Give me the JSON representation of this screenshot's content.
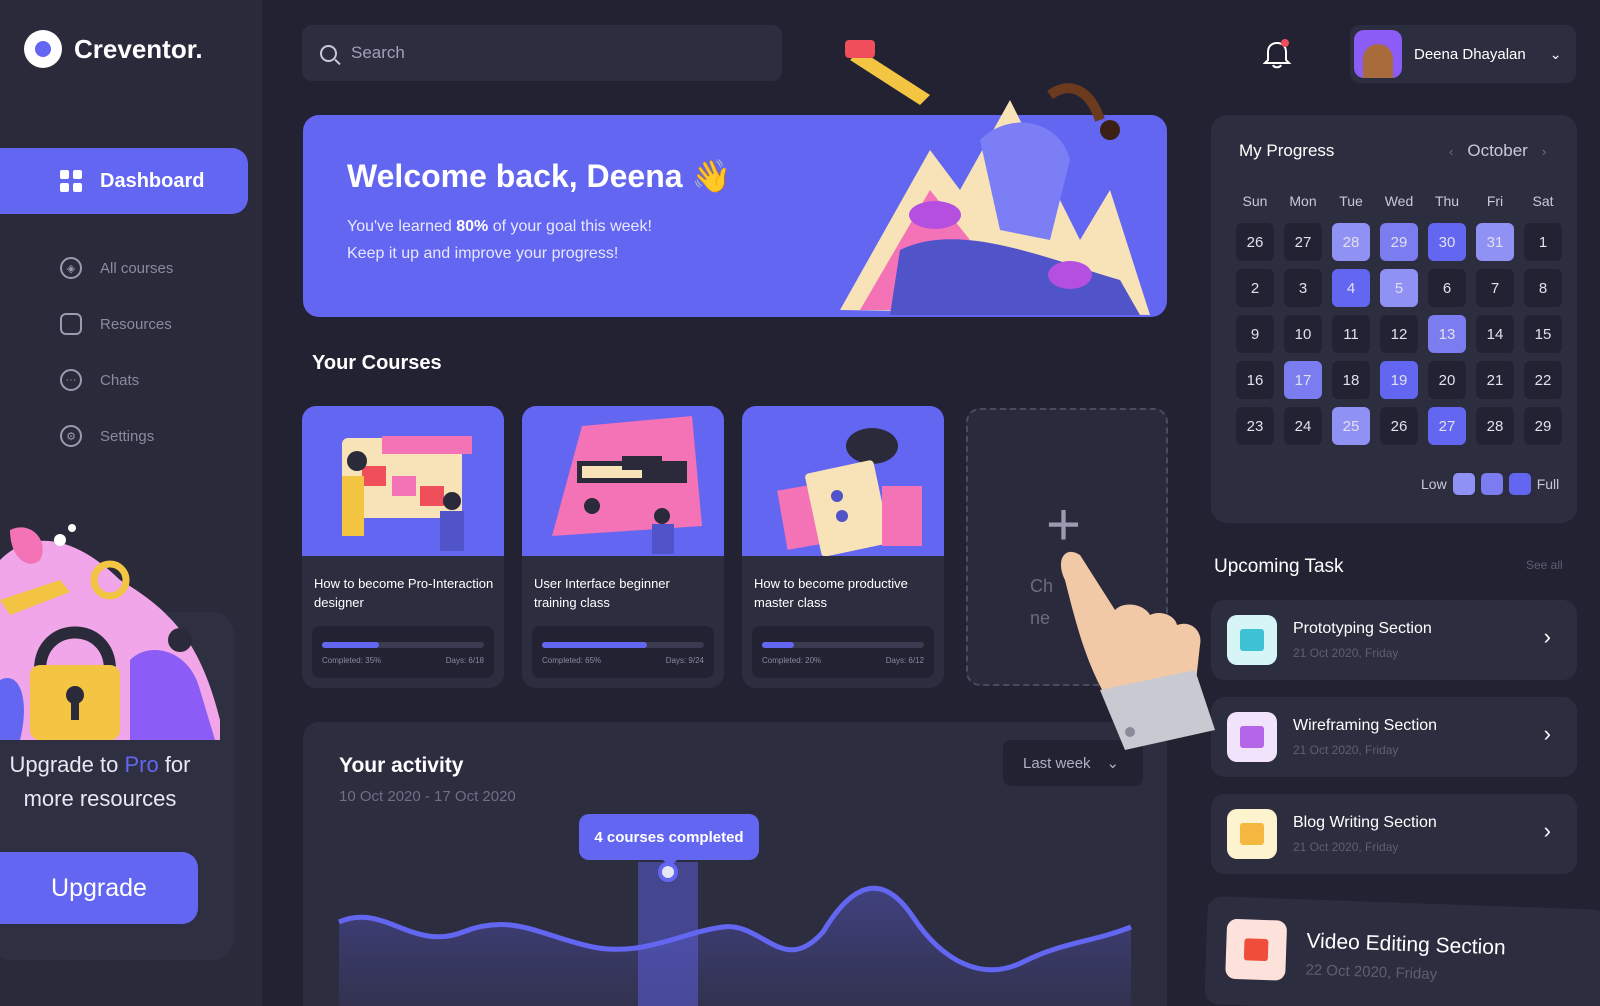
{
  "app": {
    "name": "Creventor."
  },
  "sidebar": {
    "active_item": "Dashboard",
    "items": [
      {
        "label": "All courses",
        "icon": "compass-icon"
      },
      {
        "label": "Resources",
        "icon": "folder-icon"
      },
      {
        "label": "Chats",
        "icon": "chat-icon"
      },
      {
        "label": "Settings",
        "icon": "gear-icon"
      }
    ],
    "promo": {
      "text_before": "Upgrade to ",
      "text_pro": "Pro",
      "text_after": " for more resources",
      "button": "Upgrade"
    }
  },
  "header": {
    "search_placeholder": "Search",
    "user_name": "Deena Dhayalan"
  },
  "banner": {
    "title": "Welcome back, Deena",
    "emoji": "👋",
    "line1_before": "You've learned ",
    "line1_bold": "80%",
    "line1_after": " of your goal this week!",
    "line2": "Keep it up and improve your progress!"
  },
  "courses": {
    "title": "Your Courses",
    "items": [
      {
        "title": "How to become Pro-Interaction designer",
        "completed_label": "Completed: 35%",
        "completed": 0.35,
        "days": "Days: 6/18"
      },
      {
        "title": "User Interface beginner training class",
        "completed_label": "Completed: 65%",
        "completed": 0.65,
        "days": "Days: 9/24"
      },
      {
        "title": "How to become productive master class",
        "completed_label": "Completed: 20%",
        "completed": 0.2,
        "days": "Days: 6/12"
      }
    ],
    "add_label_line1": "Ch",
    "add_label_line2": "ne"
  },
  "activity": {
    "title": "Your activity",
    "range": "10 Oct 2020 - 17 Oct 2020",
    "period_select": "Last week",
    "tooltip": "4 courses completed"
  },
  "progress": {
    "title": "My Progress",
    "month": "October",
    "weekdays": [
      "Sun",
      "Mon",
      "Tue",
      "Wed",
      "Thu",
      "Fri",
      "Sat"
    ],
    "days": [
      {
        "d": "26",
        "lv": 0
      },
      {
        "d": "27",
        "lv": 0
      },
      {
        "d": "28",
        "lv": 1
      },
      {
        "d": "29",
        "lv": 2
      },
      {
        "d": "30",
        "lv": 3
      },
      {
        "d": "31",
        "lv": 1
      },
      {
        "d": "1",
        "lv": 0
      },
      {
        "d": "2",
        "lv": 0
      },
      {
        "d": "3",
        "lv": 0
      },
      {
        "d": "4",
        "lv": 3
      },
      {
        "d": "5",
        "lv": 1
      },
      {
        "d": "6",
        "lv": 0
      },
      {
        "d": "7",
        "lv": 0
      },
      {
        "d": "8",
        "lv": 0
      },
      {
        "d": "9",
        "lv": 0
      },
      {
        "d": "10",
        "lv": 0
      },
      {
        "d": "11",
        "lv": 0
      },
      {
        "d": "12",
        "lv": 0
      },
      {
        "d": "13",
        "lv": 2
      },
      {
        "d": "14",
        "lv": 0
      },
      {
        "d": "15",
        "lv": 0
      },
      {
        "d": "16",
        "lv": 0
      },
      {
        "d": "17",
        "lv": 2
      },
      {
        "d": "18",
        "lv": 0
      },
      {
        "d": "19",
        "lv": 3
      },
      {
        "d": "20",
        "lv": 0
      },
      {
        "d": "21",
        "lv": 0
      },
      {
        "d": "22",
        "lv": 0
      },
      {
        "d": "23",
        "lv": 0
      },
      {
        "d": "24",
        "lv": 0
      },
      {
        "d": "25",
        "lv": 1
      },
      {
        "d": "26",
        "lv": 0
      },
      {
        "d": "27",
        "lv": 3
      },
      {
        "d": "28",
        "lv": 0
      },
      {
        "d": "29",
        "lv": 0
      }
    ],
    "legend_low": "Low",
    "legend_full": "Full",
    "level_colors": [
      "#222233",
      "#8f91f5",
      "#7a7cf0",
      "#6366f1"
    ]
  },
  "tasks": {
    "title": "Upcoming Task",
    "see_all": "See all",
    "items": [
      {
        "name": "Prototyping Section",
        "date": "21 Oct 2020, Friday",
        "icon_bg": "#d6f5f7",
        "icon_color": "#3ec1d3"
      },
      {
        "name": "Wireframing Section",
        "date": "21 Oct 2020, Friday",
        "icon_bg": "#f1e3fb",
        "icon_color": "#b565e8"
      },
      {
        "name": "Blog Writing Section",
        "date": "21 Oct 2020, Friday",
        "icon_bg": "#fdf3cf",
        "icon_color": "#f4b740"
      }
    ],
    "featured": {
      "name": "Video Editing Section",
      "date": "22 Oct 2020, Friday",
      "icon_bg": "#fde2dc",
      "icon_color": "#ef4e3b"
    }
  },
  "colors": {
    "accent": "#6366f1",
    "bg": "#222233",
    "card": "#2d2d40"
  }
}
